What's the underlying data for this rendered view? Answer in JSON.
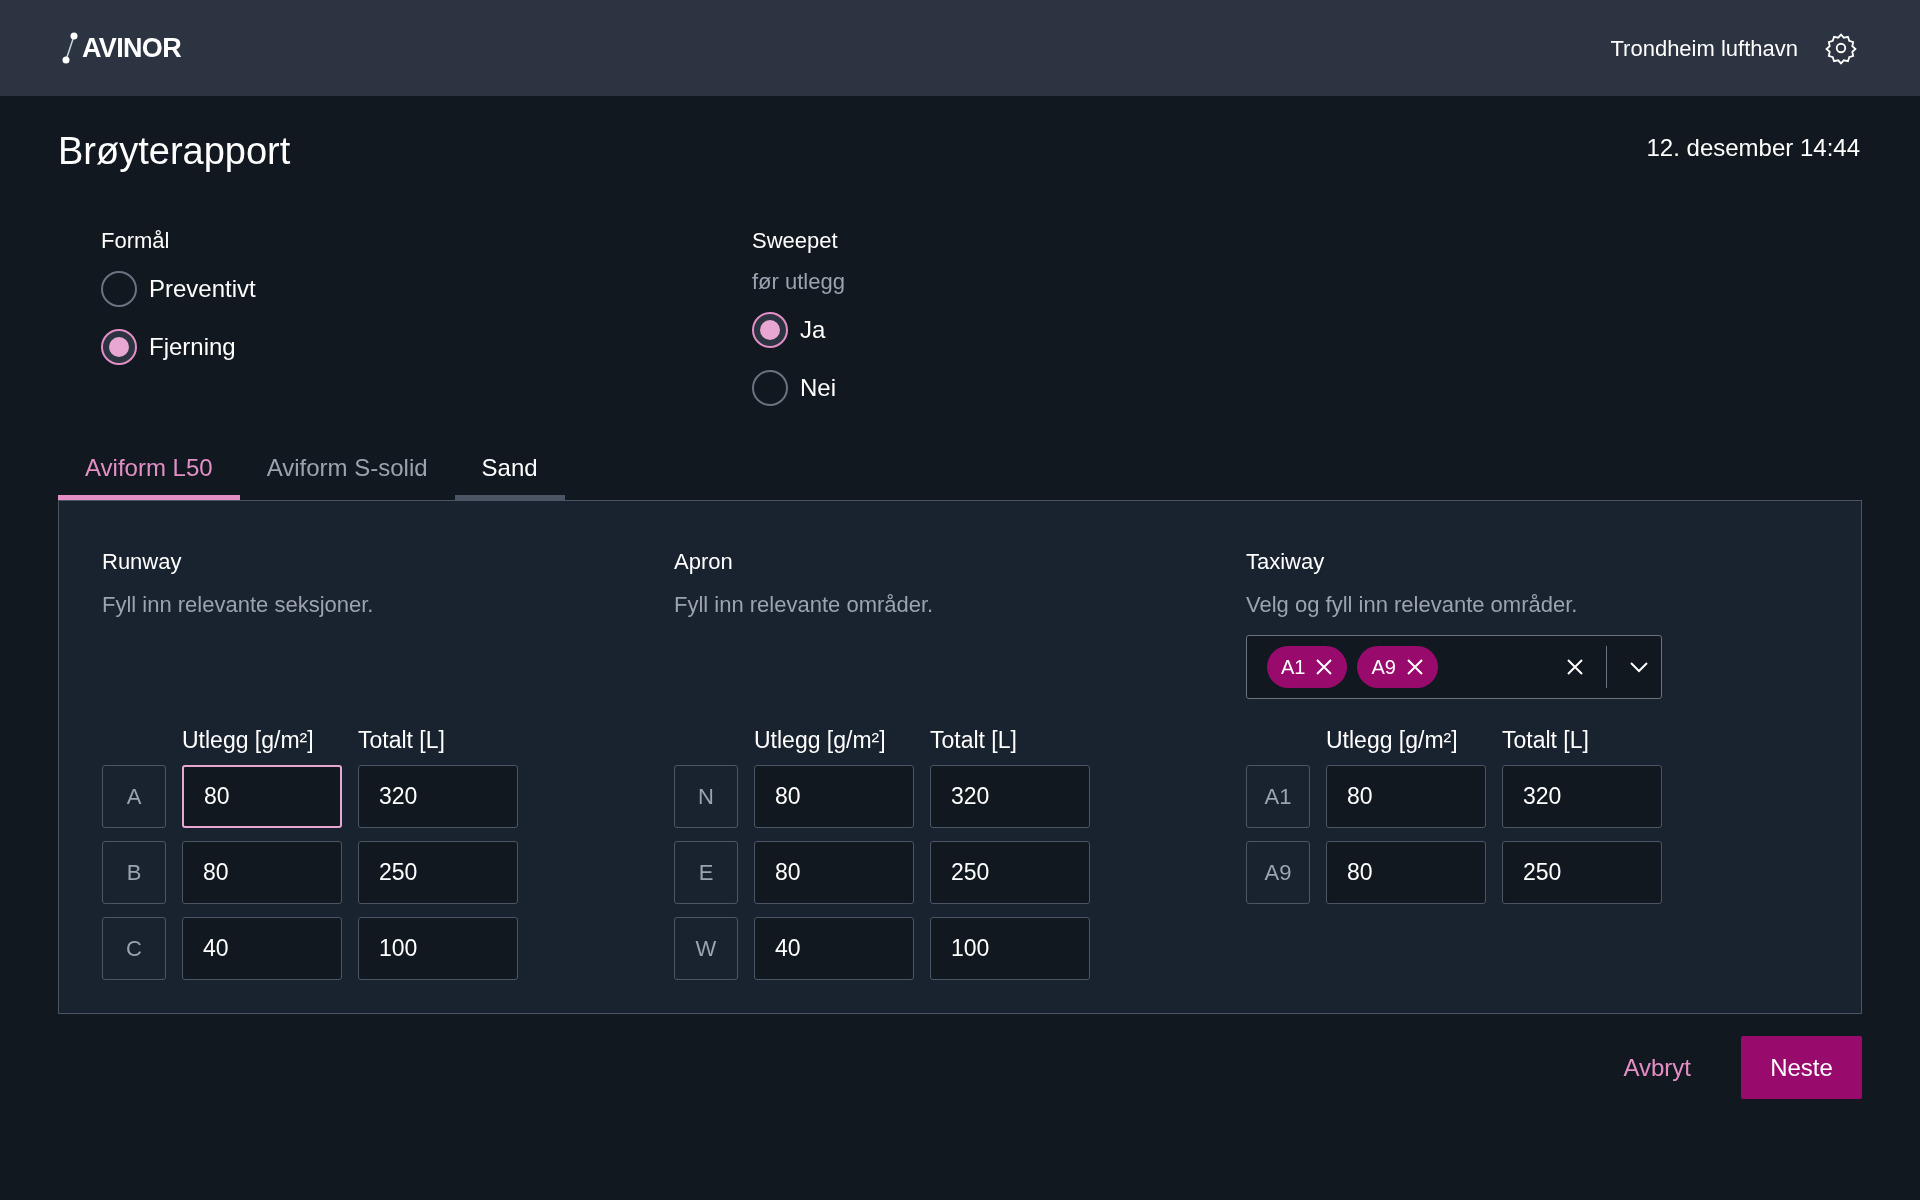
{
  "header": {
    "logo": "AVINOR",
    "location": "Trondheim lufthavn"
  },
  "page": {
    "title": "Brøyterapport",
    "datetime": "12. desember 14:44"
  },
  "formal": {
    "label": "Formål",
    "options": [
      {
        "label": "Preventivt",
        "selected": false
      },
      {
        "label": "Fjerning",
        "selected": true
      }
    ]
  },
  "sweepet": {
    "label": "Sweepet",
    "hint": "før utlegg",
    "options": [
      {
        "label": "Ja",
        "selected": true
      },
      {
        "label": "Nei",
        "selected": false
      }
    ]
  },
  "tabs": [
    {
      "label": "Aviform L50",
      "selected": true,
      "hovered": false
    },
    {
      "label": "Aviform S-solid",
      "selected": false,
      "hovered": false
    },
    {
      "label": "Sand",
      "selected": false,
      "hovered": true
    }
  ],
  "sections": [
    {
      "title": "Runway",
      "description": "Fyll inn relevante seksjoner.",
      "columns": [
        "Utlegg [g/m²]",
        "Totalt [L]"
      ],
      "rows": [
        {
          "label": "A",
          "utlegg": "80",
          "totalt": "320",
          "focused": true
        },
        {
          "label": "B",
          "utlegg": "80",
          "totalt": "250",
          "focused": false
        },
        {
          "label": "C",
          "utlegg": "40",
          "totalt": "100",
          "focused": false
        }
      ]
    },
    {
      "title": "Apron",
      "description": "Fyll inn relevante områder.",
      "columns": [
        "Utlegg [g/m²]",
        "Totalt [L]"
      ],
      "rows": [
        {
          "label": "N",
          "utlegg": "80",
          "totalt": "320",
          "focused": false
        },
        {
          "label": "E",
          "utlegg": "80",
          "totalt": "250",
          "focused": false
        },
        {
          "label": "W",
          "utlegg": "40",
          "totalt": "100",
          "focused": false
        }
      ]
    },
    {
      "title": "Taxiway",
      "description": "Velg og fyll inn relevante områder.",
      "chips": [
        "A1",
        "A9"
      ],
      "columns": [
        "Utlegg [g/m²]",
        "Totalt [L]"
      ],
      "rows": [
        {
          "label": "A1",
          "utlegg": "80",
          "totalt": "320",
          "focused": false
        },
        {
          "label": "A9",
          "utlegg": "80",
          "totalt": "250",
          "focused": false
        }
      ]
    }
  ],
  "actions": {
    "cancel": "Avbryt",
    "next": "Neste"
  }
}
